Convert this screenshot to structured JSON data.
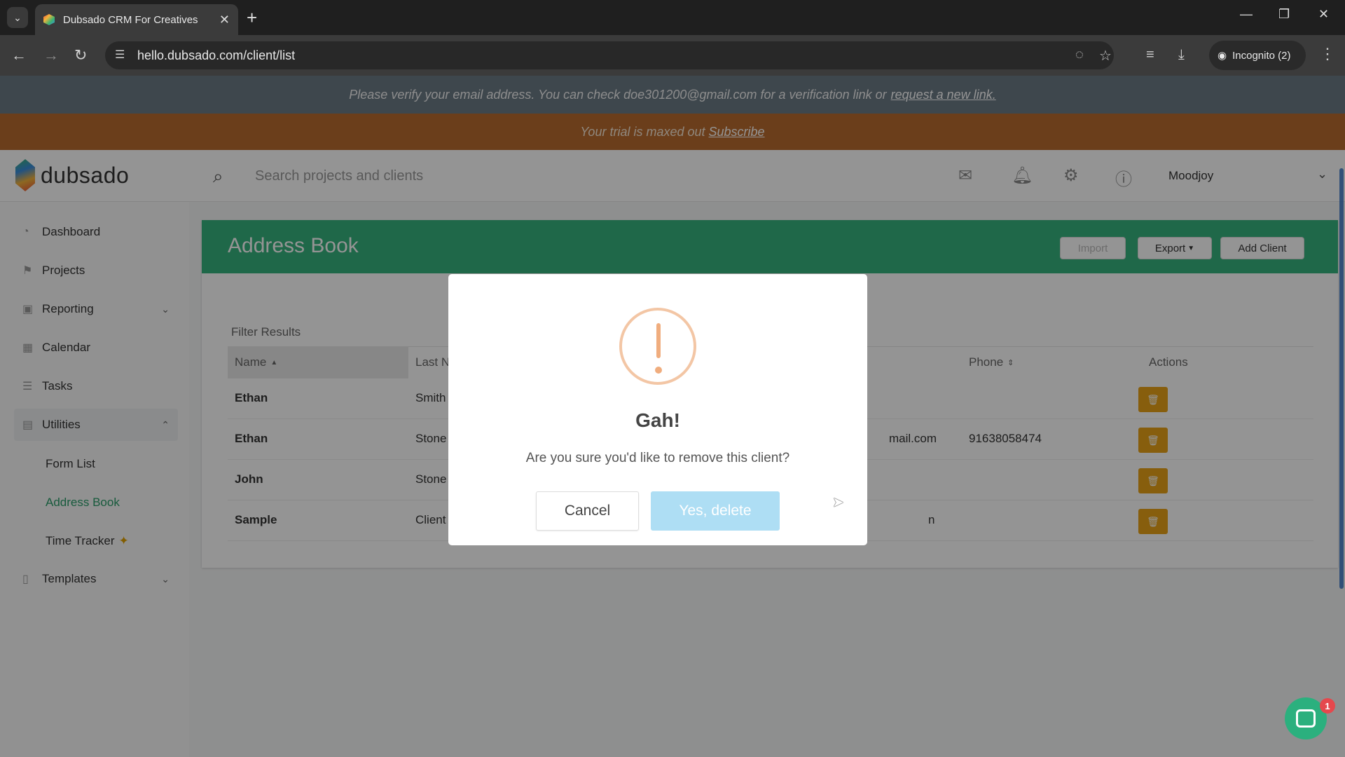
{
  "browser": {
    "tab_title": "Dubsado CRM For Creatives",
    "url": "hello.dubsado.com/client/list",
    "incognito_label": "Incognito (2)"
  },
  "banners": {
    "verify_text": "Please verify your email address. You can check doe301200@gmail.com for a verification link or",
    "verify_link": "request a new link.",
    "trial_text": "Your trial is maxed out",
    "trial_link": "Subscribe"
  },
  "topnav": {
    "logo_text": "dubsado",
    "search_placeholder": "Search projects and clients",
    "user_name": "Moodjoy"
  },
  "sidebar": {
    "items": [
      {
        "label": "Dashboard",
        "icon": "dashboard-icon"
      },
      {
        "label": "Projects",
        "icon": "projects-icon"
      },
      {
        "label": "Reporting",
        "icon": "reporting-icon"
      },
      {
        "label": "Calendar",
        "icon": "calendar-icon"
      },
      {
        "label": "Tasks",
        "icon": "tasks-icon"
      },
      {
        "label": "Utilities",
        "icon": "utilities-icon"
      },
      {
        "label": "Templates",
        "icon": "templates-icon"
      }
    ],
    "sub_items": [
      {
        "label": "Form List"
      },
      {
        "label": "Address Book",
        "active": true
      },
      {
        "label": "Time Tracker"
      }
    ]
  },
  "address_book": {
    "title": "Address Book",
    "import_label": "Import",
    "export_label": "Export",
    "add_client_label": "Add Client",
    "filter_label": "Filter Results",
    "columns": [
      "Name",
      "Last N",
      "Phone",
      "Actions"
    ],
    "rows": [
      {
        "first": "Ethan",
        "last": "Smith",
        "email": "",
        "phone": ""
      },
      {
        "first": "Ethan",
        "last": "Stone",
        "email": "mail.com",
        "phone": "91638058474"
      },
      {
        "first": "John",
        "last": "Stone",
        "email": "",
        "phone": ""
      },
      {
        "first": "Sample",
        "last": "Client",
        "email": "n",
        "phone": ""
      }
    ]
  },
  "modal": {
    "title": "Gah!",
    "message": "Are you sure you'd like to remove this client?",
    "cancel_label": "Cancel",
    "confirm_label": "Yes, delete"
  },
  "chat": {
    "badge_count": "1"
  },
  "colors": {
    "brand_green": "#36b37e",
    "trial_orange": "#b86c2f",
    "delete_yellow": "#e8a317",
    "confirm_blue": "#aedef4"
  }
}
